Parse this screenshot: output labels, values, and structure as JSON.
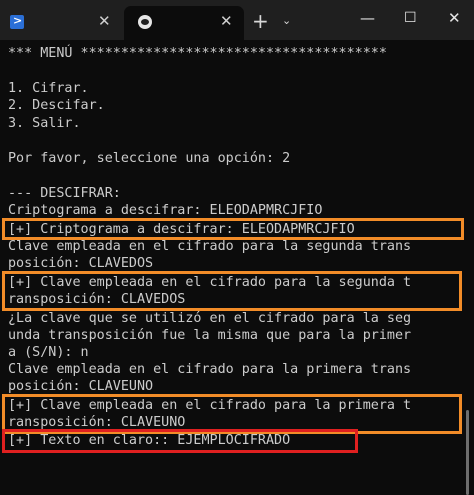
{
  "titlebar": {
    "tabs": [
      {
        "icon": "powershell-icon",
        "close_label": "✕"
      },
      {
        "icon": "linux-icon",
        "close_label": "✕"
      }
    ],
    "new_tab_label": "+",
    "dropdown_label": "⌄",
    "minimize_label": "—",
    "maximize_label": "☐",
    "close_label": "✕"
  },
  "terminal": {
    "lines": [
      "*** MENÚ **************************************",
      "",
      "1. Cifrar.",
      "2. Descifar.",
      "3. Salir.",
      "",
      "Por favor, seleccione una opción: 2",
      "",
      "--- DESCIFRAR:",
      "Criptograma a descifrar: ELEODAPMRCJFIO",
      "[+] Criptograma a descifrar: ELEODAPMRCJFIO",
      "Clave empleada en el cifrado para la segunda trans",
      "posición: CLAVEDOS",
      "[+] Clave empleada en el cifrado para la segunda t",
      "ransposición: CLAVEDOS",
      "¿La clave que se utilizó en el cifrado para la seg",
      "unda transposición fue la misma que para la primer",
      "a (S/N): n",
      "Clave empleada en el cifrado para la primera trans",
      "posición: CLAVEUNO",
      "[+] Clave empleada en el cifrado para la primera t",
      "ransposición: CLAVEUNO",
      "[+] Texto en claro:: EJEMPLOCIFRADO"
    ]
  },
  "colors": {
    "terminal_bg": "#0c0c0c",
    "titlebar_bg": "#1f1f1f",
    "text": "#cccccc",
    "highlight_orange": "#f28c28",
    "highlight_red": "#e02020"
  }
}
